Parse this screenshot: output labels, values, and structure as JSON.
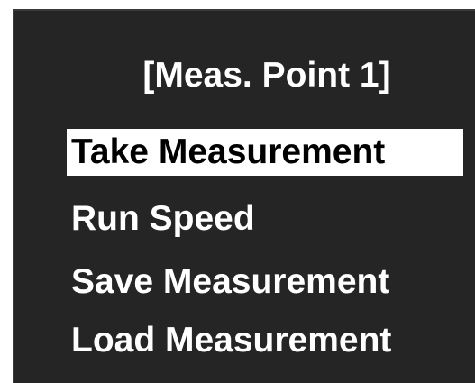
{
  "screen": {
    "title": "[Meas. Point 1]",
    "menu": {
      "items": [
        {
          "label": "Take Measurement",
          "selected": true
        },
        {
          "label": "Run Speed",
          "selected": false
        },
        {
          "label": "Save Measurement",
          "selected": false
        },
        {
          "label": "Load Measurement",
          "selected": false
        }
      ]
    }
  },
  "colors": {
    "background": "#252525",
    "text": "#ffffff",
    "selection_background": "#ffffff",
    "selection_text": "#000000"
  }
}
